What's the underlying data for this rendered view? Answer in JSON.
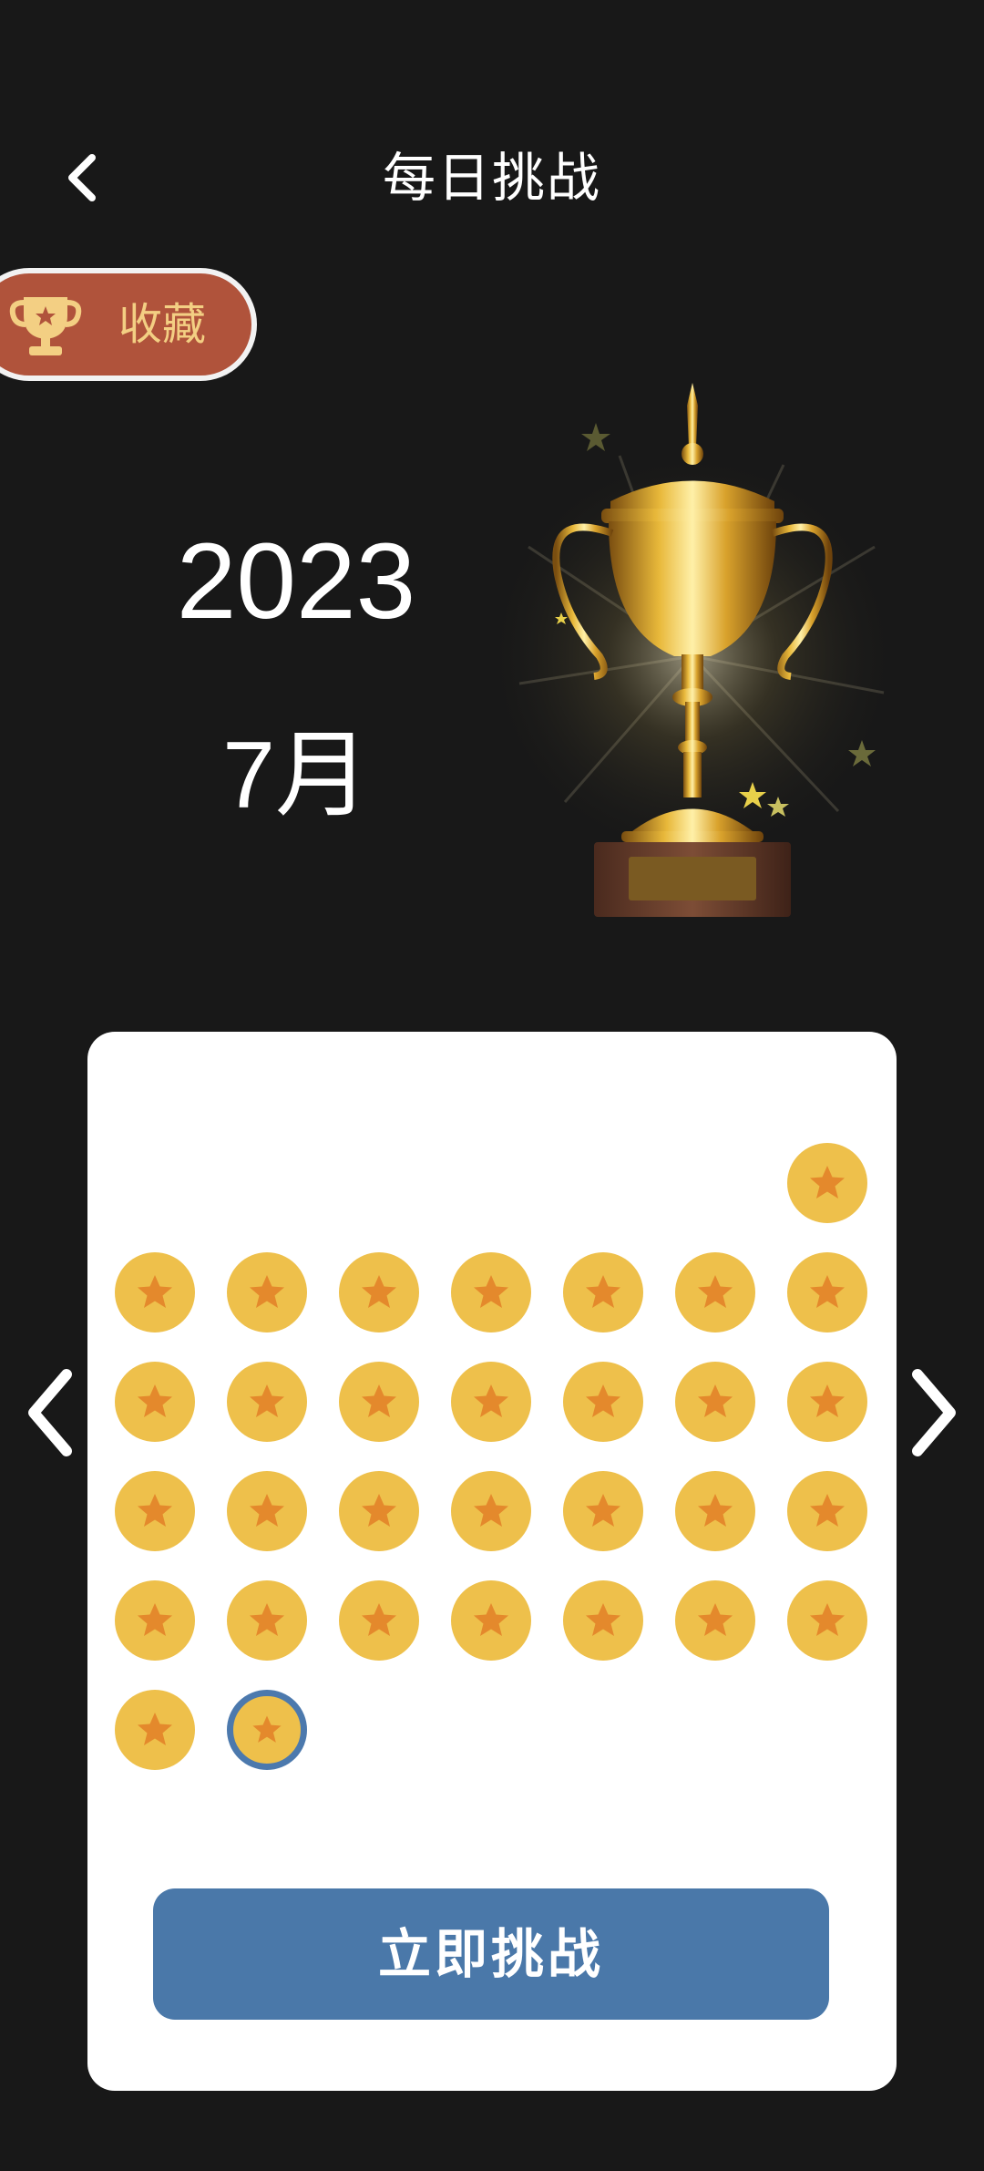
{
  "header": {
    "title": "每日挑战",
    "back_icon": "chevron-left-icon"
  },
  "collection": {
    "label": "收藏",
    "icon": "trophy-icon",
    "colors": {
      "background": "#b0533b",
      "text": "#f3cf83"
    }
  },
  "date": {
    "year": "2023",
    "month": "7月"
  },
  "calendar": {
    "first_weekday_index": 6,
    "days_in_month": 31,
    "completed_days": 31,
    "today": 31,
    "day_icon": "star-icon",
    "colors": {
      "coin": "#eec04b",
      "star": "#e4892c",
      "today_ring": "#4c79ad"
    }
  },
  "actions": {
    "challenge_label": "立即挑战",
    "prev_icon": "chevron-left-icon",
    "next_icon": "chevron-right-icon"
  },
  "colors": {
    "accent": "#4a78a9",
    "background": "#181818"
  }
}
